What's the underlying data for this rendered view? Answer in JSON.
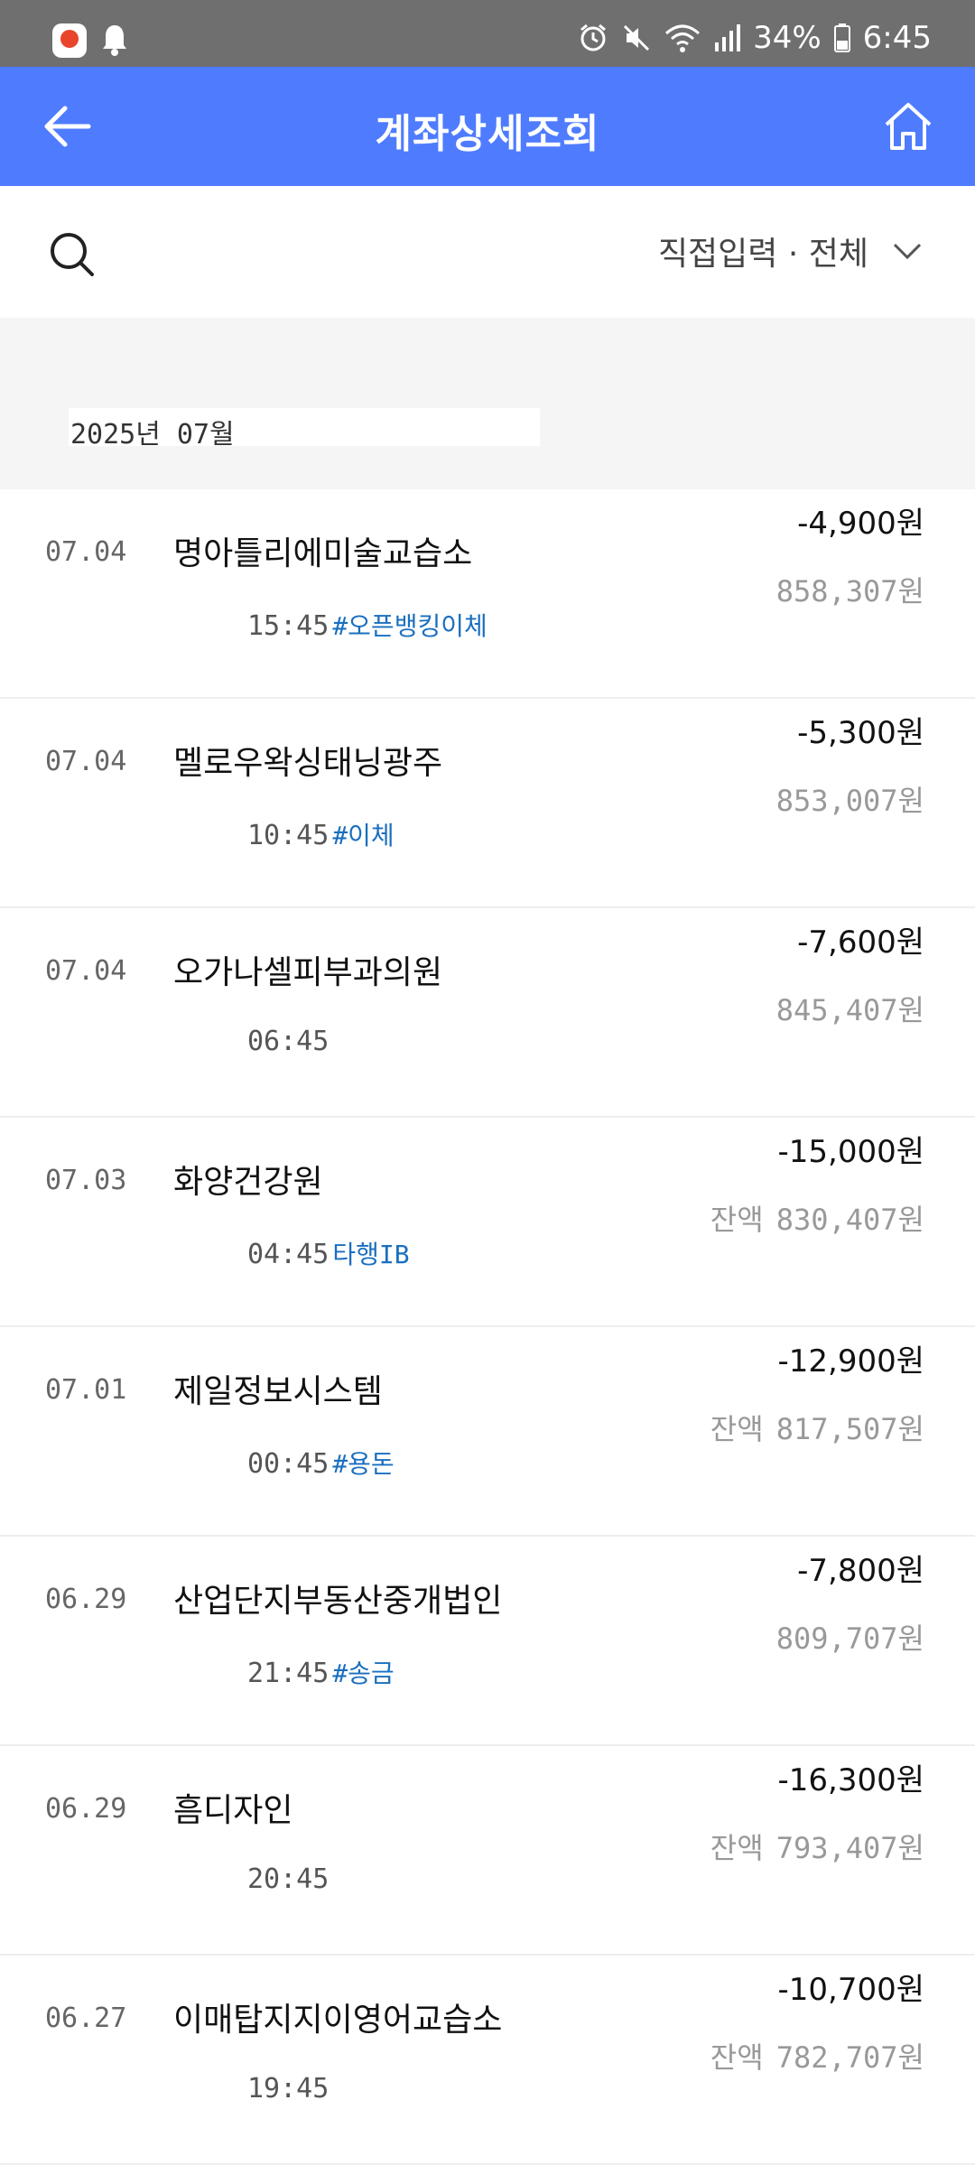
{
  "status_bar": {
    "battery": "34%",
    "time": "6:45"
  },
  "header": {
    "title": "계좌상세조회"
  },
  "filter": {
    "label": "직접입력 · 전체"
  },
  "month": {
    "label": "2025년 07월"
  },
  "transactions": [
    {
      "date": "07.04",
      "merchant": "명아틀리에미술교습소",
      "time": "15:45",
      "tag": "#오픈뱅킹이체",
      "amount": "-4,900원",
      "balance_label": "",
      "balance": "858,307원"
    },
    {
      "date": "07.04",
      "merchant": "멜로우왁싱태닝광주",
      "time": "10:45",
      "tag": "#이체",
      "amount": "-5,300원",
      "balance_label": "",
      "balance": "853,007원"
    },
    {
      "date": "07.04",
      "merchant": "오가나셀피부과의원",
      "time": "06:45",
      "tag": "",
      "amount": "-7,600원",
      "balance_label": "",
      "balance": "845,407원"
    },
    {
      "date": "07.03",
      "merchant": "화양건강원",
      "time": "04:45",
      "tag": "타행IB",
      "amount": "-15,000원",
      "balance_label": "잔액",
      "balance": "830,407원"
    },
    {
      "date": "07.01",
      "merchant": "제일정보시스템",
      "time": "00:45",
      "tag": "#용돈",
      "amount": "-12,900원",
      "balance_label": "잔액",
      "balance": "817,507원"
    },
    {
      "date": "06.29",
      "merchant": "산업단지부동산중개법인",
      "time": "21:45",
      "tag": "#송금",
      "amount": "-7,800원",
      "balance_label": "",
      "balance": "809,707원"
    },
    {
      "date": "06.29",
      "merchant": "흠디자인",
      "time": "20:45",
      "tag": "",
      "amount": "-16,300원",
      "balance_label": "잔액",
      "balance": "793,407원"
    },
    {
      "date": "06.27",
      "merchant": "이매탑지지이영어교습소",
      "time": "19:45",
      "tag": "",
      "amount": "-10,700원",
      "balance_label": "잔액",
      "balance": "782,707원"
    }
  ]
}
